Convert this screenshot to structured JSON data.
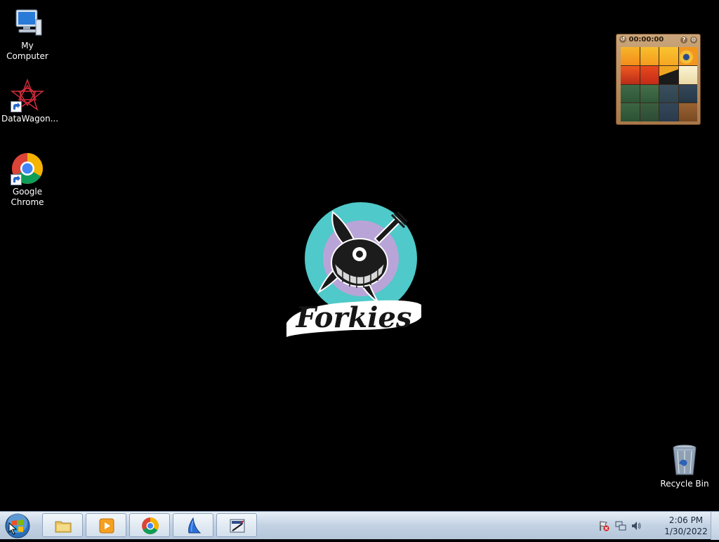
{
  "desktop": {
    "icons": [
      {
        "label": "My Computer",
        "icon": "computer-icon"
      },
      {
        "label": "DataWagon...",
        "icon": "datawagon-icon"
      },
      {
        "label": "Google Chrome",
        "icon": "chrome-icon"
      },
      {
        "label": "Recycle Bin",
        "icon": "recycle-bin-icon"
      }
    ],
    "wallpaper_logo_text": "Forkies"
  },
  "gadget": {
    "timer": "00:00:00",
    "help_label": "?",
    "options_label": "⚙"
  },
  "taskbar": {
    "buttons": [
      {
        "name": "file-explorer",
        "icon": "folder-icon"
      },
      {
        "name": "media-player",
        "icon": "media-player-icon"
      },
      {
        "name": "chrome",
        "icon": "chrome-icon"
      },
      {
        "name": "app-sail",
        "icon": "sail-app-icon"
      },
      {
        "name": "app-editor",
        "icon": "editor-app-icon"
      }
    ],
    "clock": {
      "time": "2:06 PM",
      "date": "1/30/2022"
    }
  },
  "colors": {
    "taskbar_accent": "#c3d2e3",
    "logo_teal": "#4fc9c9",
    "logo_lavender": "#b9a4d8"
  }
}
